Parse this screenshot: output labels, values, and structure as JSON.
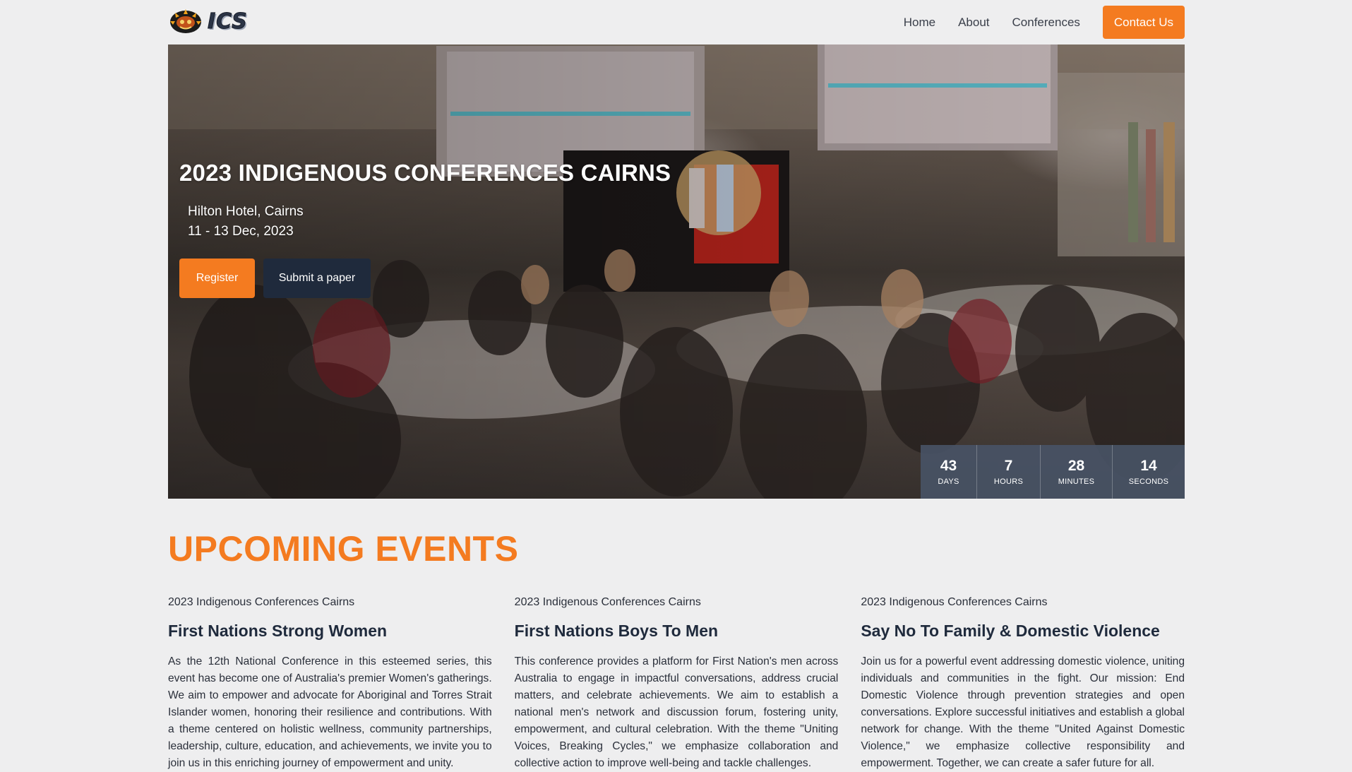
{
  "brand": {
    "logo_text": "ICS"
  },
  "nav": {
    "links": [
      "Home",
      "About",
      "Conferences"
    ],
    "cta": "Contact Us"
  },
  "hero": {
    "title": "2023 INDIGENOUS CONFERENCES CAIRNS",
    "venue": "Hilton Hotel, Cairns",
    "dates": "11 - 13 Dec, 2023",
    "register_label": "Register",
    "submit_label": "Submit a paper",
    "countdown": [
      {
        "value": "43",
        "label": "DAYS"
      },
      {
        "value": "7",
        "label": "HOURS"
      },
      {
        "value": "28",
        "label": "MINUTES"
      },
      {
        "value": "14",
        "label": "SECONDS"
      }
    ]
  },
  "upcoming": {
    "title": "UPCOMING EVENTS",
    "events": [
      {
        "subtitle": "2023 Indigenous Conferences Cairns",
        "title": "First Nations Strong Women",
        "description": "As the 12th National Conference in this esteemed series, this event has become one of Australia's premier Women's gatherings. We aim to empower and advocate for Aboriginal and Torres Strait Islander women, honoring their resilience and contributions. With a theme centered on holistic wellness, community partnerships, leadership, culture, education, and achievements, we invite you to join us in this enriching journey of empowerment and unity."
      },
      {
        "subtitle": "2023 Indigenous Conferences Cairns",
        "title": "First Nations Boys To Men",
        "description": "This conference provides a platform for First Nation's men across Australia to engage in impactful conversations, address crucial matters, and celebrate achievements. We aim to establish a national men's network and discussion forum, fostering unity, empowerment, and cultural celebration. With the theme \"Uniting Voices, Breaking Cycles,\" we emphasize collaboration and collective action to improve well-being and tackle challenges."
      },
      {
        "subtitle": "2023 Indigenous Conferences Cairns",
        "title": "Say No To Family & Domestic Violence",
        "description": "Join us for a powerful event addressing domestic violence, uniting individuals and communities in the fight. Our mission: End Domestic Violence through prevention strategies and open conversations. Explore successful initiatives and establish a global network for change. With the theme \"United Against Domestic Violence,\" we emphasize collective responsibility and empowerment. Together, we can create a safer future for all."
      }
    ]
  },
  "colors": {
    "accent": "#f47b20",
    "navy": "#1f2a3c",
    "page_bg": "#eeeeef",
    "countdown_bg": "#485265"
  },
  "icons": {
    "logo_emblem": "logo-emblem-icon"
  }
}
